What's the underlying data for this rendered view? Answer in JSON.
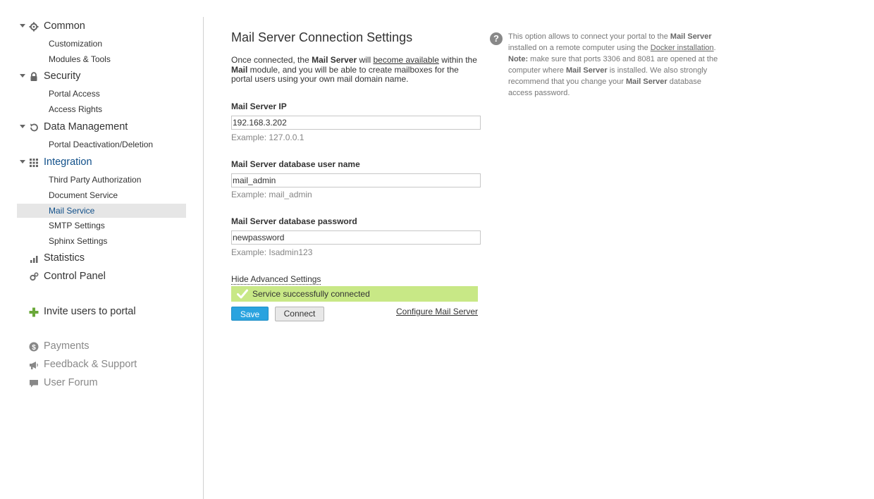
{
  "sidebar": {
    "groups": [
      {
        "label": "Common",
        "icon": "gear-icon",
        "items": [
          "Customization",
          "Modules & Tools"
        ]
      },
      {
        "label": "Security",
        "icon": "lock-icon",
        "items": [
          "Portal Access",
          "Access Rights"
        ]
      },
      {
        "label": "Data Management",
        "icon": "restore-icon",
        "items": [
          "Portal Deactivation/Deletion"
        ]
      },
      {
        "label": "Integration",
        "icon": "grid-icon",
        "items": [
          "Third Party Authorization",
          "Document Service",
          "Mail Service",
          "SMTP Settings",
          "Sphinx Settings"
        ],
        "selected_item": "Mail Service"
      }
    ],
    "statistics": "Statistics",
    "control_panel": "Control Panel",
    "invite": "Invite users to portal",
    "payments": "Payments",
    "feedback": "Feedback & Support",
    "forum": "User Forum",
    "accent_color": "#11508a"
  },
  "main": {
    "title": "Mail Server Connection Settings",
    "intro": {
      "p1": "Once connected, the ",
      "b1": "Mail Server",
      "p2": " will ",
      "u1": "become available",
      "p3": " within the ",
      "b2": "Mail",
      "p4": " module, and you will be able to create mailboxes for the portal users using your own mail domain name."
    },
    "fields": [
      {
        "label": "Mail Server IP",
        "value": "192.168.3.202",
        "hint": "Example: 127.0.0.1"
      },
      {
        "label": "Mail Server database user name",
        "value": "mail_admin",
        "hint": "Example: mail_admin"
      },
      {
        "label": "Mail Server database password",
        "value": "newpassword",
        "hint": "Example: Isadmin123"
      }
    ],
    "advanced_toggle": "Hide Advanced Settings",
    "status_message": "Service successfully connected",
    "status_color": "#c8e886",
    "save_label": "Save",
    "connect_label": "Connect",
    "configure_link": "Configure Mail Server"
  },
  "help": {
    "t1": "This option allows to connect your portal to the ",
    "b1": "Mail Server",
    "t2": " installed on a remote computer using the ",
    "u1": "Docker installation",
    "t3": ".",
    "note_label": "Note:",
    "t4": " make sure that ports 3306 and 8081 are opened at the computer where ",
    "b2": "Mail Server",
    "t5": " is installed. We also strongly recommend that you change your ",
    "b3": "Mail Server",
    "t6": " database access password."
  }
}
